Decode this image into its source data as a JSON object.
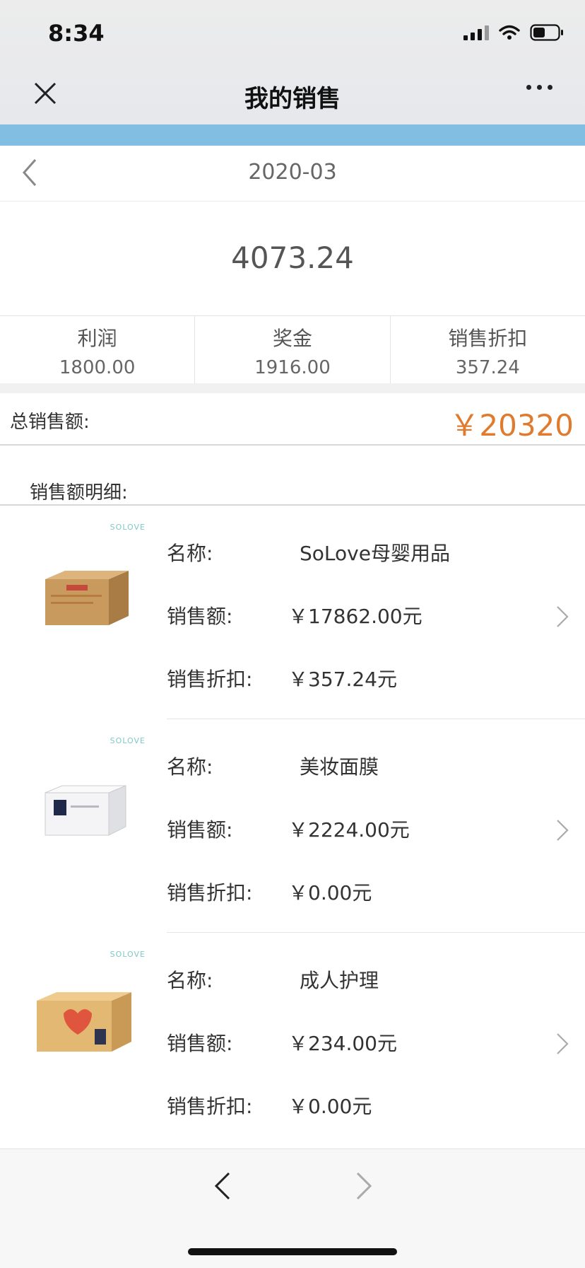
{
  "status_bar": {
    "time": "8:34"
  },
  "header": {
    "title": "我的销售"
  },
  "month": {
    "label": "2020-03"
  },
  "summary": {
    "amount": "4073.24",
    "stats": [
      {
        "label": "利润",
        "value": "1800.00"
      },
      {
        "label": "奖金",
        "value": "1916.00"
      },
      {
        "label": "销售折扣",
        "value": "357.24"
      }
    ],
    "total_label": "总销售额:",
    "total_amount": "￥20320"
  },
  "detail": {
    "title": "销售额明细:",
    "items": [
      {
        "brand": "SOLOVE",
        "name_label": "名称:",
        "name": "SoLove母婴用品",
        "sales_label": "销售额:",
        "sales": "￥17862.00元",
        "discount_label": "销售折扣:",
        "discount": "￥357.24元"
      },
      {
        "brand": "SOLOVE",
        "name_label": "名称:",
        "name": "美妆面膜",
        "sales_label": "销售额:",
        "sales": "￥2224.00元",
        "discount_label": "销售折扣:",
        "discount": "￥0.00元"
      },
      {
        "brand": "SOLOVE",
        "name_label": "名称:",
        "name": "成人护理",
        "sales_label": "销售额:",
        "sales": "￥234.00元",
        "discount_label": "销售折扣:",
        "discount": "￥0.00元"
      }
    ]
  },
  "colors": {
    "accent": "#e07a2d",
    "band": "#82bde2"
  },
  "icons": [
    "close-icon",
    "more-icon",
    "back-chevron-icon",
    "forward-chevron-icon",
    "signal-icon",
    "wifi-icon",
    "battery-icon"
  ]
}
